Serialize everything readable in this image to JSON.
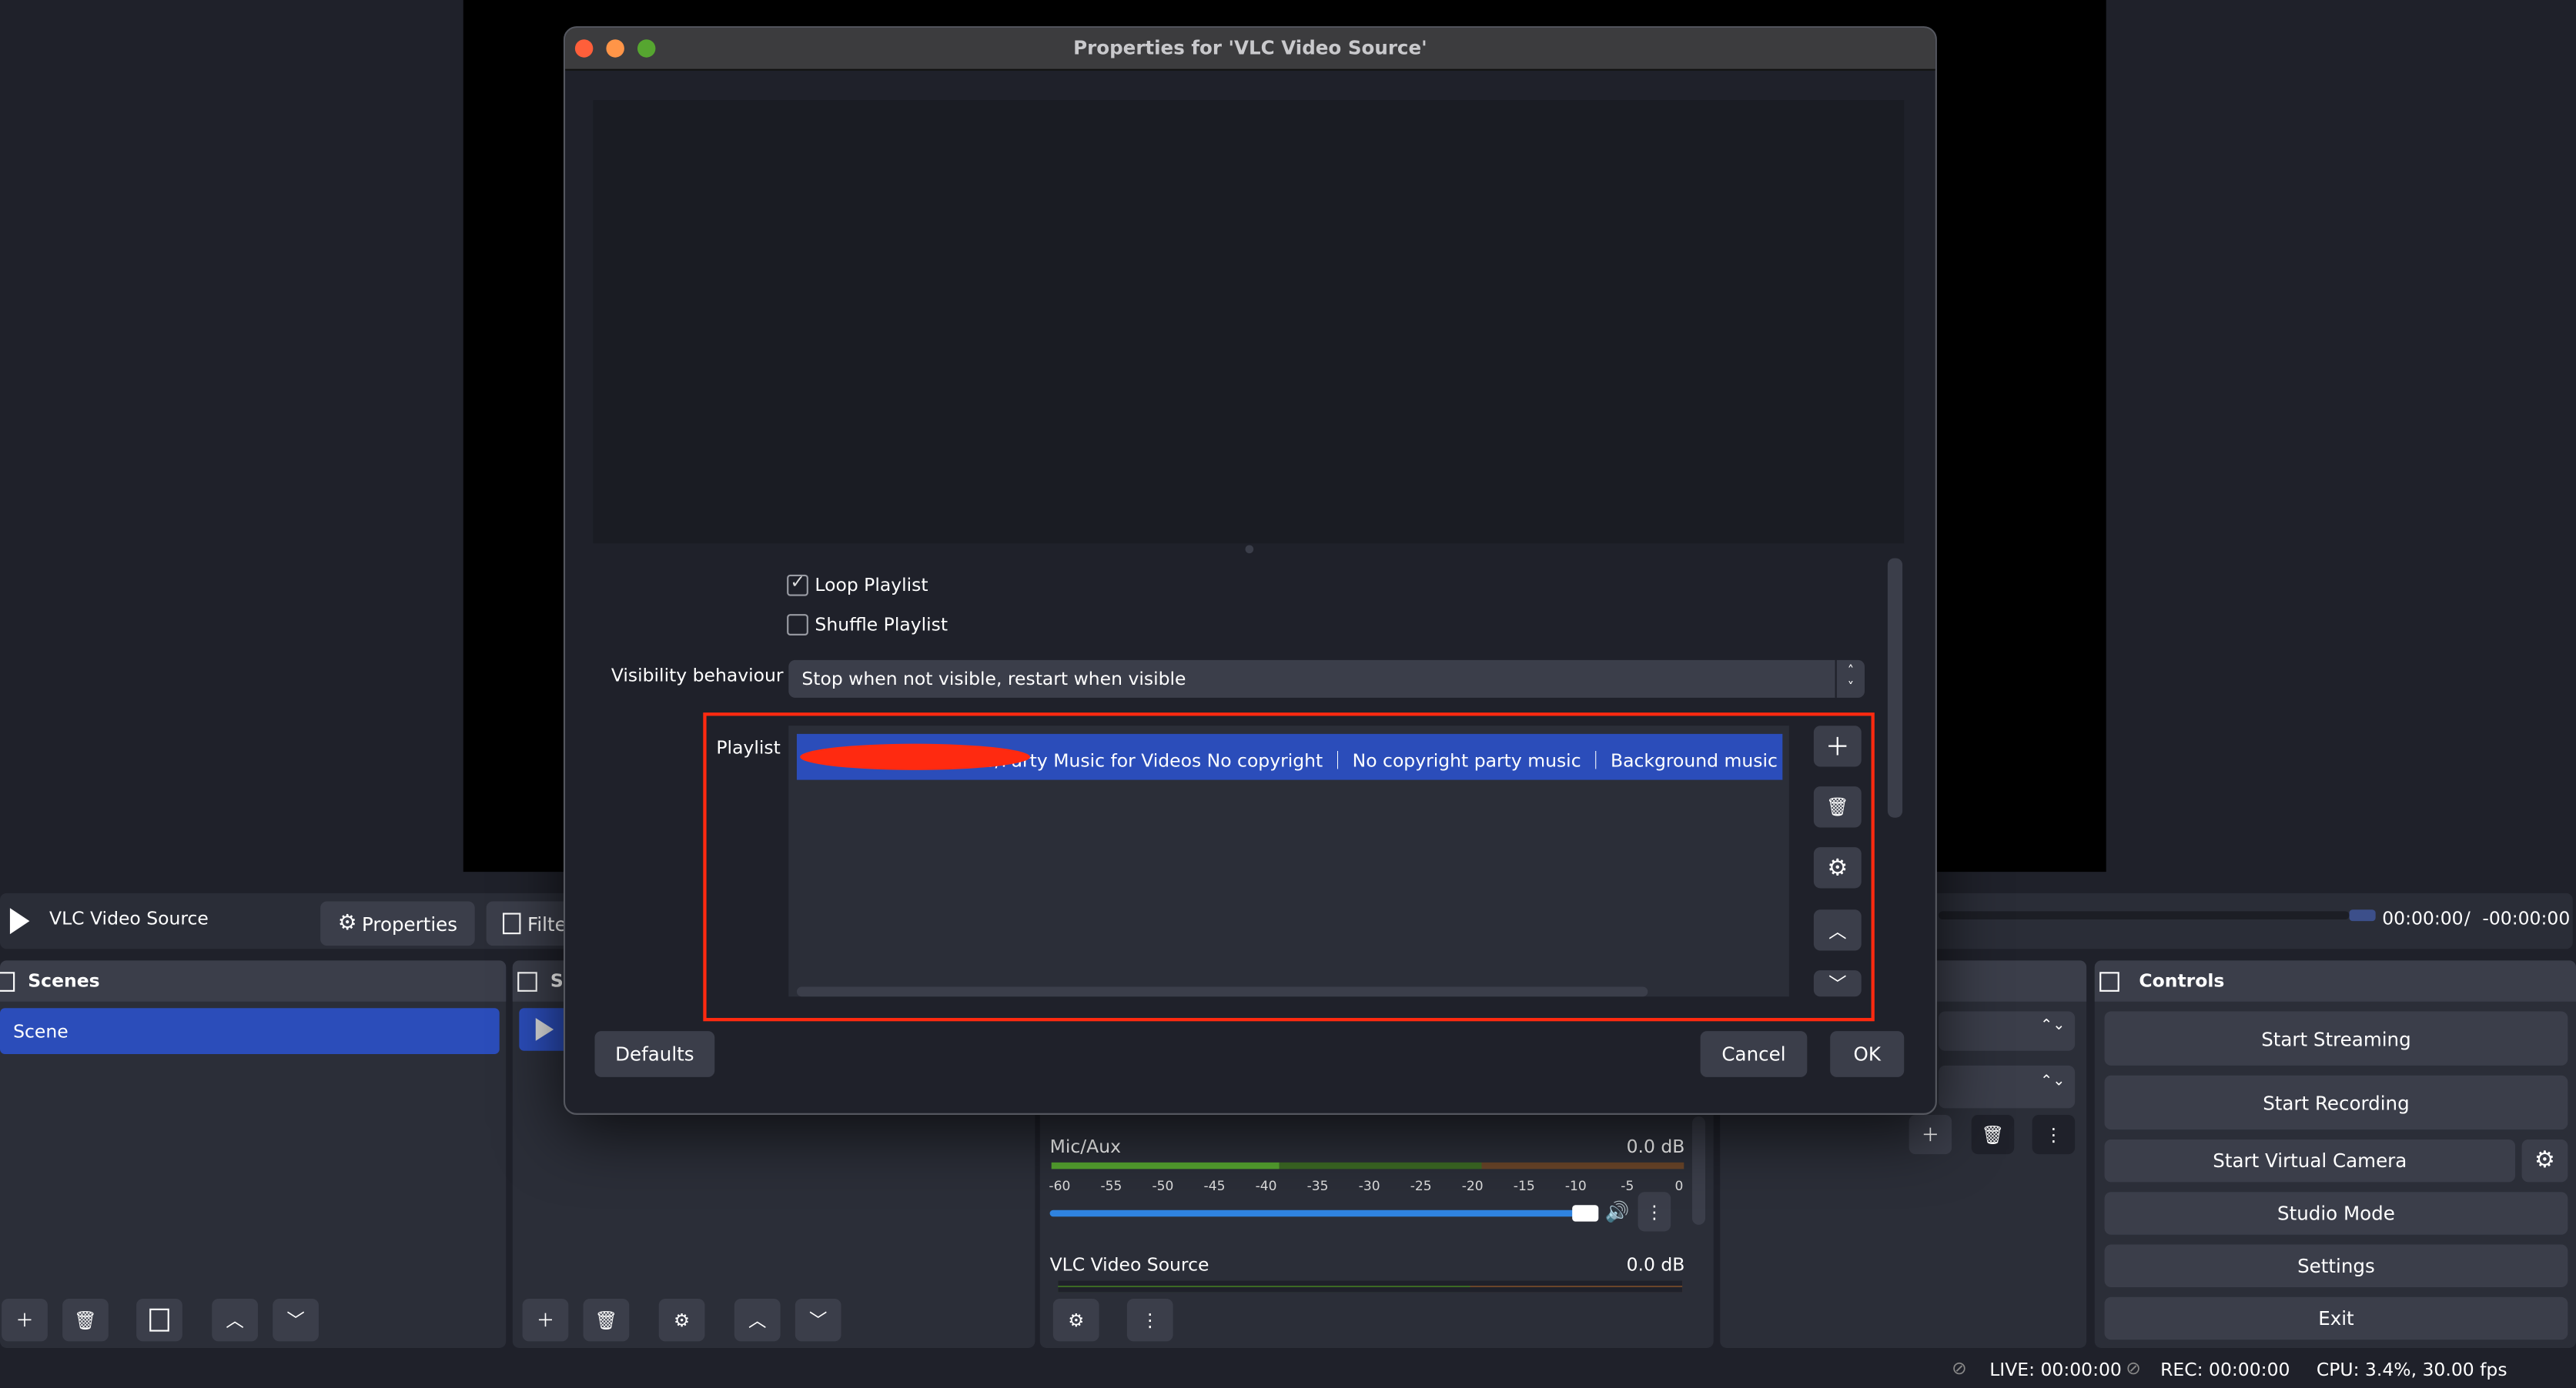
{
  "source_toolbar": {
    "source_name": "VLC Video Source",
    "properties_label": "Properties",
    "filters_label": "Filters",
    "time_current": "00:00:00",
    "time_separator": "/",
    "time_remaining": "-00:00:00"
  },
  "scenes": {
    "title": "Scenes",
    "items": [
      "Scene"
    ]
  },
  "sources": {
    "title": "Sources"
  },
  "audio_mixer": {
    "channels": [
      {
        "name": "Mic/Aux",
        "level": "0.0 dB",
        "volume_percent": 100
      },
      {
        "name": "VLC Video Source",
        "level": "0.0 dB"
      }
    ],
    "ticks": [
      "-60",
      "-55",
      "-50",
      "-45",
      "-40",
      "-35",
      "-30",
      "-25",
      "-20",
      "-15",
      "-10",
      "-5",
      "0"
    ]
  },
  "controls": {
    "title": "Controls",
    "start_streaming": "Start Streaming",
    "start_recording": "Start Recording",
    "start_virtual_camera": "Start Virtual Camera",
    "studio_mode": "Studio Mode",
    "settings": "Settings",
    "exit": "Exit"
  },
  "status_bar": {
    "live": "LIVE: 00:00:00",
    "rec": "REC: 00:00:00",
    "cpu": "CPU: 3.4%, 30.00 fps"
  },
  "dialog": {
    "title": "Properties for 'VLC Video Source'",
    "loop_playlist": {
      "label": "Loop Playlist",
      "checked": true
    },
    "shuffle_playlist": {
      "label": "Shuffle Playlist",
      "checked": false
    },
    "visibility_label": "Visibility behaviour",
    "visibility_value": "Stop when not visible, restart when visible",
    "playlist_label": "Playlist",
    "playlist_items": [
      "…s/Party Music for Videos No copyright ｜ No copyright party music ｜ Background music"
    ],
    "defaults_label": "Defaults",
    "cancel_label": "Cancel",
    "ok_label": "OK"
  },
  "colors": {
    "accent": "#2b4dba",
    "highlight_box": "#ff2a10",
    "close": "#ff5f3a",
    "minimize": "#ff9548",
    "zoom": "#56a630"
  }
}
